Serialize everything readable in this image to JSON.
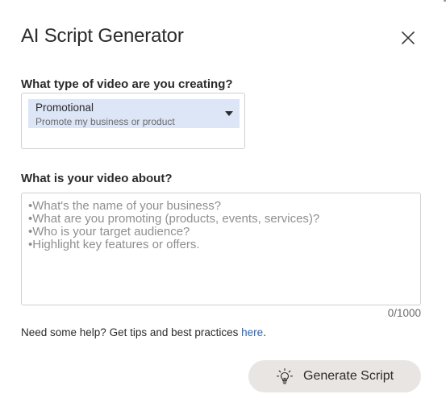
{
  "dialog": {
    "title": "AI Script Generator",
    "close_icon": "close-icon"
  },
  "video_type": {
    "label": "What type of video are you creating?",
    "selected": {
      "title": "Promotional",
      "subtitle": "Promote my business or product"
    },
    "caret_icon": "caret-down-icon"
  },
  "video_about": {
    "label": "What is your video about?",
    "value": "",
    "placeholder_lines": [
      "What's the name of your business?",
      "What are you promoting (products, events, services)?",
      "Who is your target audience?",
      "Highlight key features or offers."
    ],
    "counter": "0/1000"
  },
  "help": {
    "text": "Need some help? Get tips and best practices ",
    "link_text": "here",
    "suffix": "."
  },
  "generate_button": {
    "label": "Generate Script",
    "icon": "lightbulb-icon"
  },
  "colors": {
    "selected_option_bg": "#dde6f6",
    "link": "#2b64b8",
    "button_bg": "#e9e5e2"
  }
}
